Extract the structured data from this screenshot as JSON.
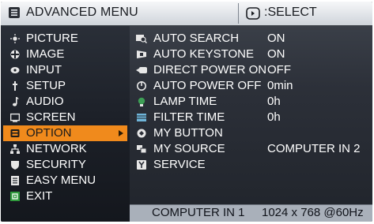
{
  "header": {
    "title": "ADVANCED MENU",
    "select_label": ":SELECT",
    "select_icon": "remote-select-icon"
  },
  "left_menu": [
    {
      "label": "PICTURE",
      "icon": "picture-icon"
    },
    {
      "label": "IMAGE",
      "icon": "image-icon"
    },
    {
      "label": "INPUT",
      "icon": "input-icon"
    },
    {
      "label": "SETUP",
      "icon": "setup-icon"
    },
    {
      "label": "AUDIO",
      "icon": "audio-icon"
    },
    {
      "label": "SCREEN",
      "icon": "screen-icon"
    },
    {
      "label": "OPTION",
      "icon": "option-icon",
      "selected": true
    },
    {
      "label": "NETWORK",
      "icon": "network-icon"
    },
    {
      "label": "SECURITY",
      "icon": "security-icon"
    },
    {
      "label": "EASY MENU",
      "icon": "easy-menu-icon"
    },
    {
      "label": "EXIT",
      "icon": "exit-icon"
    }
  ],
  "option_menu": [
    {
      "label": "AUTO SEARCH",
      "value": "ON",
      "icon": "auto-search-icon"
    },
    {
      "label": "AUTO KEYSTONE",
      "value": "ON",
      "icon": "auto-keystone-icon"
    },
    {
      "label": "DIRECT POWER ON",
      "value": "OFF",
      "icon": "direct-power-on-icon"
    },
    {
      "label": "AUTO POWER OFF",
      "value": "0min",
      "icon": "auto-power-off-icon"
    },
    {
      "label": "LAMP TIME",
      "value": "0h",
      "icon": "lamp-time-icon"
    },
    {
      "label": "FILTER TIME",
      "value": "0h",
      "icon": "filter-time-icon"
    },
    {
      "label": "MY BUTTON",
      "value": "",
      "icon": "my-button-icon"
    },
    {
      "label": "MY SOURCE",
      "value": "COMPUTER IN 2",
      "icon": "my-source-icon"
    },
    {
      "label": "SERVICE",
      "value": "",
      "icon": "service-icon"
    }
  ],
  "footer": {
    "input": "COMPUTER IN 1",
    "resolution": "1024 x 768 @60Hz"
  },
  "colors": {
    "highlight": "#f08a1c",
    "header_bg": "#dfe3e8",
    "footer_bg": "#a9b0ba"
  }
}
